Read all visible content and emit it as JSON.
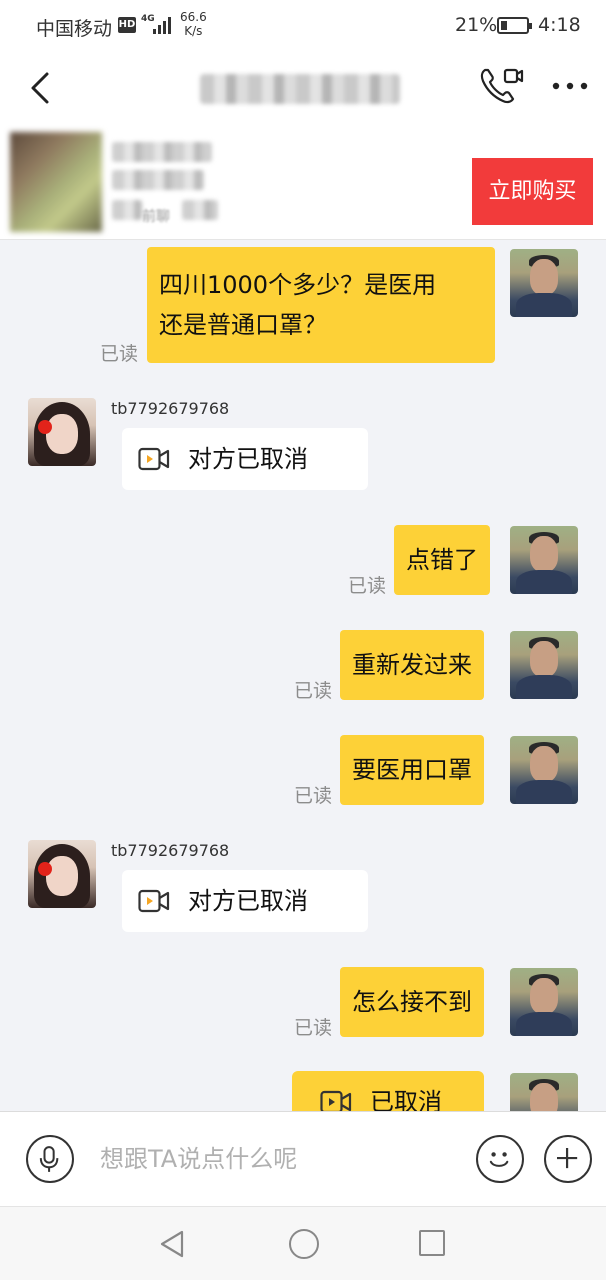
{
  "status_bar": {
    "carrier": "中国移动",
    "hd": "HD",
    "network": "4G",
    "speed_value": "66.6",
    "speed_unit": "K/s",
    "battery_pct": "21%",
    "time": "4:18"
  },
  "product": {
    "sub_label": "前聊",
    "buy_label": "立即购买"
  },
  "messages": [
    {
      "from": "me",
      "text_line1": "四川1000个多少？是医用",
      "text_line2": "还是普通口罩？",
      "status": "已读"
    },
    {
      "from": "them",
      "sender": "tb7792679768",
      "text": "对方已取消",
      "icon": "video-call-icon"
    },
    {
      "from": "me",
      "text": "点错了",
      "status": "已读"
    },
    {
      "from": "me",
      "text": "重新发过来",
      "status": "已读"
    },
    {
      "from": "me",
      "text": "要医用口罩",
      "status": "已读"
    },
    {
      "from": "them",
      "sender": "tb7792679768",
      "text": "对方已取消",
      "icon": "video-call-icon"
    },
    {
      "from": "me",
      "text": "怎么接不到",
      "status": "已读"
    },
    {
      "from": "me",
      "text": "已取消",
      "icon": "video-call-icon"
    }
  ],
  "input": {
    "placeholder": "想跟TA说点什么呢"
  },
  "colors": {
    "my_bubble": "#fdd137",
    "their_bubble": "#ffffff",
    "buy_button": "#f23b3b",
    "chat_bg": "#f2f3f7"
  }
}
